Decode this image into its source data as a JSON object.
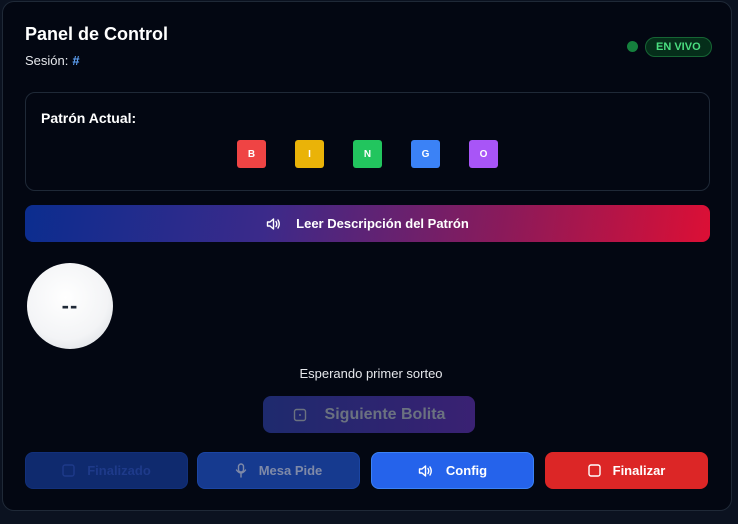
{
  "header": {
    "title": "Panel de Control",
    "session_label": "Sesión:",
    "session_value": "#",
    "live_badge": "EN VIVO"
  },
  "pattern": {
    "label": "Patrón Actual:",
    "letters": [
      {
        "letter": "B",
        "color": "#ef4444"
      },
      {
        "letter": "I",
        "color": "#eab308"
      },
      {
        "letter": "N",
        "color": "#22c55e"
      },
      {
        "letter": "G",
        "color": "#3b82f6"
      },
      {
        "letter": "O",
        "color": "#a855f7"
      }
    ]
  },
  "read_button": {
    "label": "Leer Descripción del Patrón",
    "icon": "speaker-icon"
  },
  "ball": {
    "value": "--"
  },
  "status_text": "Esperando primer sorteo",
  "next_button": {
    "label": "Siguiente Bolita",
    "icon": "dice-icon"
  },
  "actions": {
    "finalizado": {
      "label": "Finalizado",
      "icon": "square-icon"
    },
    "mesa_pide": {
      "label": "Mesa Pide",
      "icon": "microphone-icon"
    },
    "config": {
      "label": "Config",
      "icon": "speaker-icon"
    },
    "finalizar": {
      "label": "Finalizar",
      "icon": "square-icon"
    }
  },
  "colors": {
    "accent_blue": "#2563eb",
    "danger_red": "#dc2626",
    "live_green": "#4ade80"
  }
}
